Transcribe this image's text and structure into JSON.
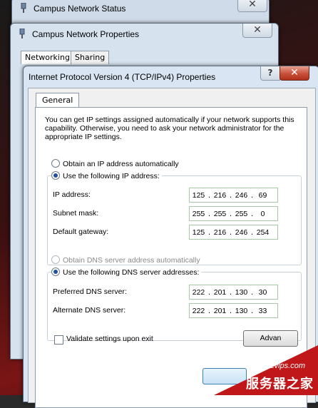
{
  "windows": {
    "status": {
      "title": "Campus Network Status"
    },
    "properties": {
      "title": "Campus Network Properties",
      "tabs": [
        "Networking",
        "Sharing"
      ]
    },
    "ipv4": {
      "title": "Internet Protocol Version 4 (TCP/IPv4) Properties",
      "help_label": "?",
      "tab": "General",
      "intro": "You can get IP settings assigned automatically if your network supports this capability. Otherwise, you need to ask your network administrator for the appropriate IP settings.",
      "ip_auto_label": "Obtain an IP address automatically",
      "ip_manual_label": "Use the following IP address:",
      "ip_fields": [
        {
          "label": "IP address:",
          "octets": [
            "125",
            "216",
            "246",
            "69"
          ]
        },
        {
          "label": "Subnet mask:",
          "octets": [
            "255",
            "255",
            "255",
            "0"
          ]
        },
        {
          "label": "Default gateway:",
          "octets": [
            "125",
            "216",
            "246",
            "254"
          ]
        }
      ],
      "dns_auto_label": "Obtain DNS server address automatically",
      "dns_manual_label": "Use the following DNS server addresses:",
      "dns_fields": [
        {
          "label": "Preferred DNS server:",
          "octets": [
            "222",
            "201",
            "130",
            "30"
          ]
        },
        {
          "label": "Alternate DNS server:",
          "octets": [
            "222",
            "201",
            "130",
            "33"
          ]
        }
      ],
      "validate_label": "Validate settings upon exit",
      "advanced_label": "Advan"
    }
  },
  "close_glyph": "✕",
  "watermark": {
    "url": "www.zzvips.com",
    "text": "服务器之家"
  },
  "colors": {
    "selected_radio": "#2050a0",
    "close_button": "#c8503a",
    "watermark_red": "#c0181a"
  }
}
